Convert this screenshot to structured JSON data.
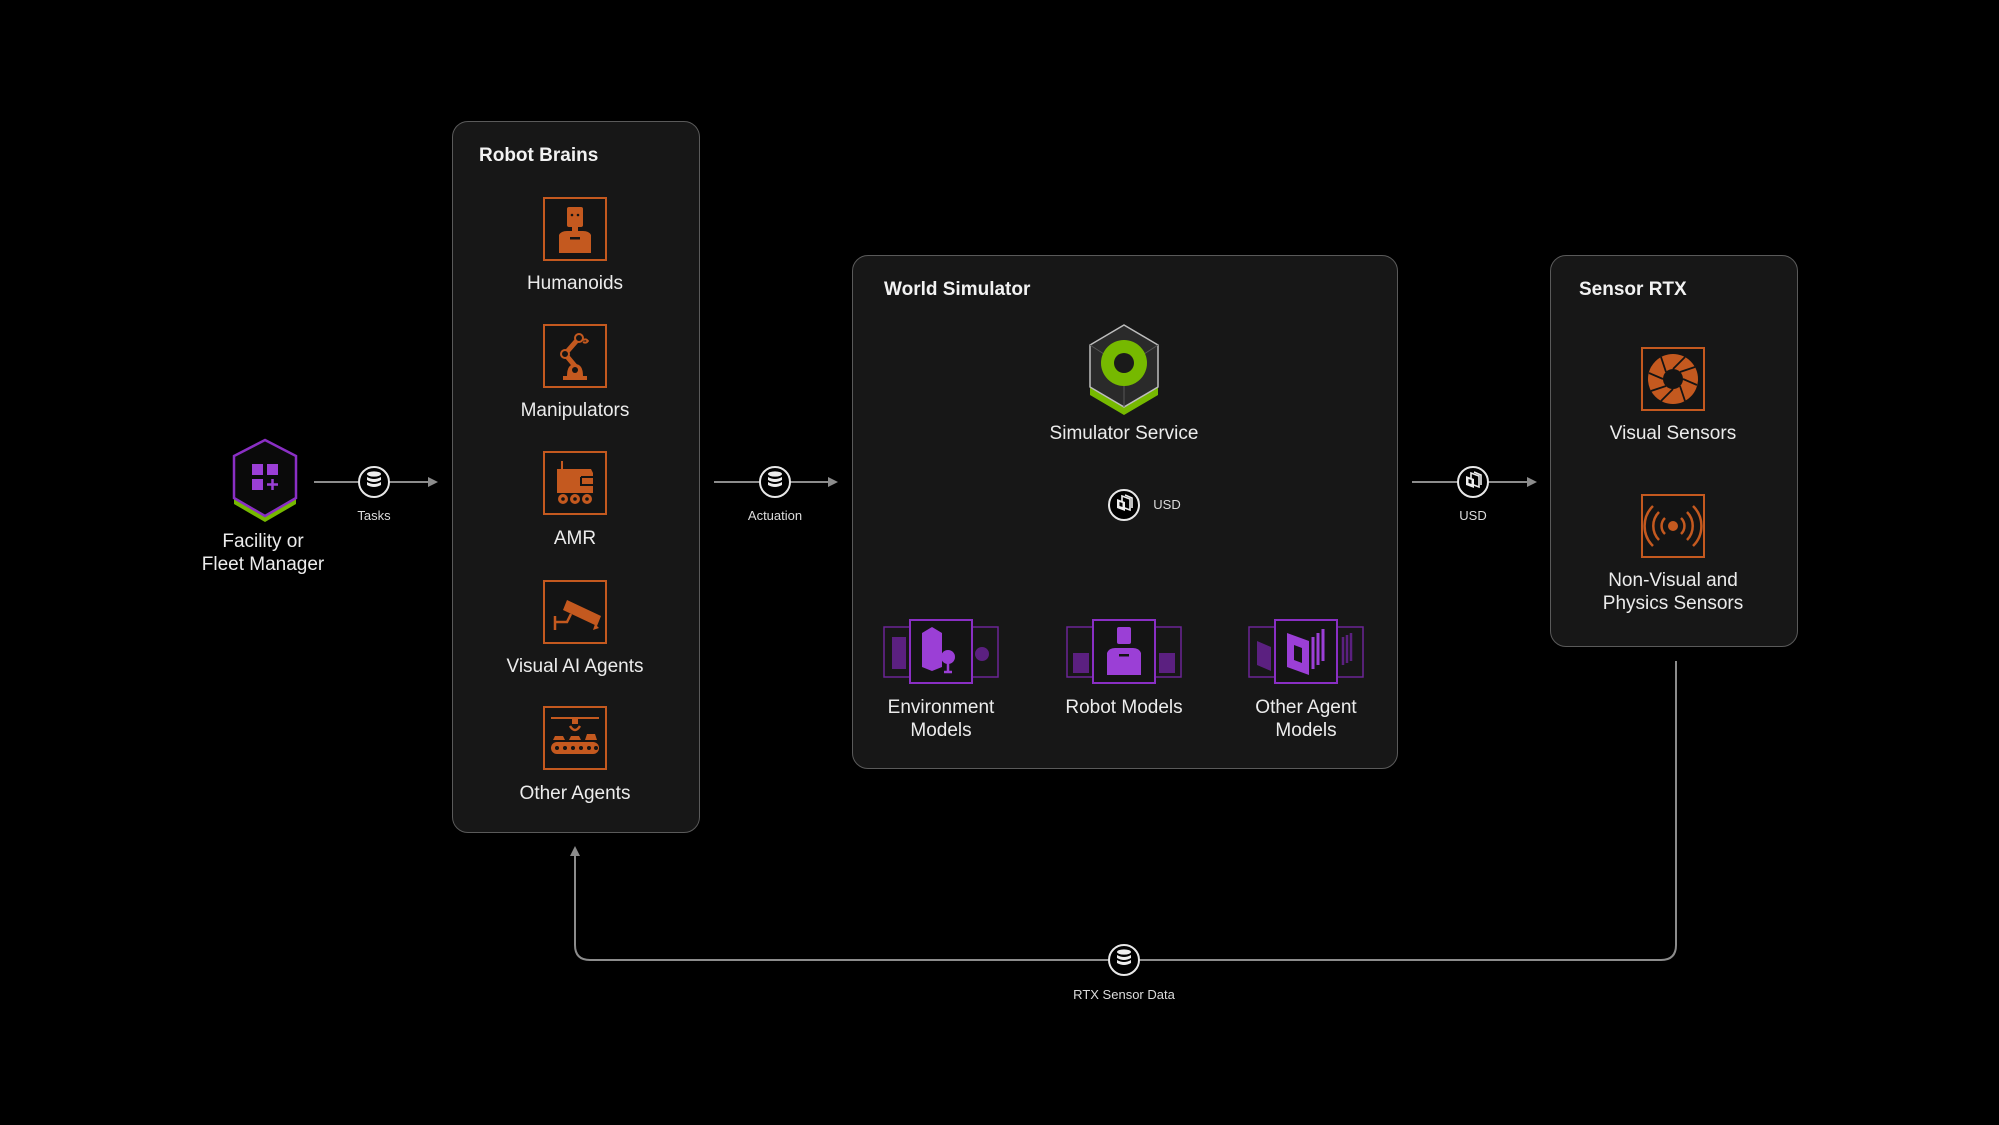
{
  "diagram": {
    "facility": {
      "label_line1": "Facility or",
      "label_line2": "Fleet Manager",
      "icon": "facility-manager-hex-icon"
    },
    "connectors": {
      "tasks": {
        "label": "Tasks",
        "icon": "database-icon"
      },
      "actuation": {
        "label": "Actuation",
        "icon": "database-icon"
      },
      "usd_inner": {
        "label": "USD",
        "icon": "usd-layers-icon"
      },
      "usd_outer": {
        "label": "USD",
        "icon": "usd-layers-icon"
      },
      "rtx_sensor_data": {
        "label": "RTX Sensor Data",
        "icon": "database-icon"
      }
    },
    "robot_brains": {
      "title": "Robot Brains",
      "items": [
        {
          "label": "Humanoids",
          "icon": "humanoid-icon"
        },
        {
          "label": "Manipulators",
          "icon": "robot-arm-icon"
        },
        {
          "label": "AMR",
          "icon": "amr-vehicle-icon"
        },
        {
          "label": "Visual AI Agents",
          "icon": "security-camera-icon"
        },
        {
          "label": "Other Agents",
          "icon": "conveyor-icon"
        }
      ]
    },
    "world_simulator": {
      "title": "World Simulator",
      "service": {
        "label": "Simulator Service",
        "icon": "simulator-service-icon"
      },
      "models": [
        {
          "label_line1": "Environment",
          "label_line2": "Models",
          "icon": "building-icon"
        },
        {
          "label_line1": "Robot Models",
          "label_line2": "",
          "icon": "robot-model-icon"
        },
        {
          "label_line1": "Other Agent",
          "label_line2": "Models",
          "icon": "layers-icon"
        }
      ]
    },
    "sensor_rtx": {
      "title": "Sensor RTX",
      "items": [
        {
          "label_line1": "Visual Sensors",
          "label_line2": "",
          "icon": "aperture-icon"
        },
        {
          "label_line1": "Non-Visual and",
          "label_line2": "Physics Sensors",
          "icon": "radar-signal-icon"
        }
      ]
    },
    "colors": {
      "background": "#000000",
      "panel": "#171717",
      "panel_border": "#5a5a5a",
      "agent_orange": "#c4591f",
      "model_purple": "#8a2fc4",
      "nvidia_green": "#76b900",
      "line_gray": "#8c8c8c"
    }
  }
}
